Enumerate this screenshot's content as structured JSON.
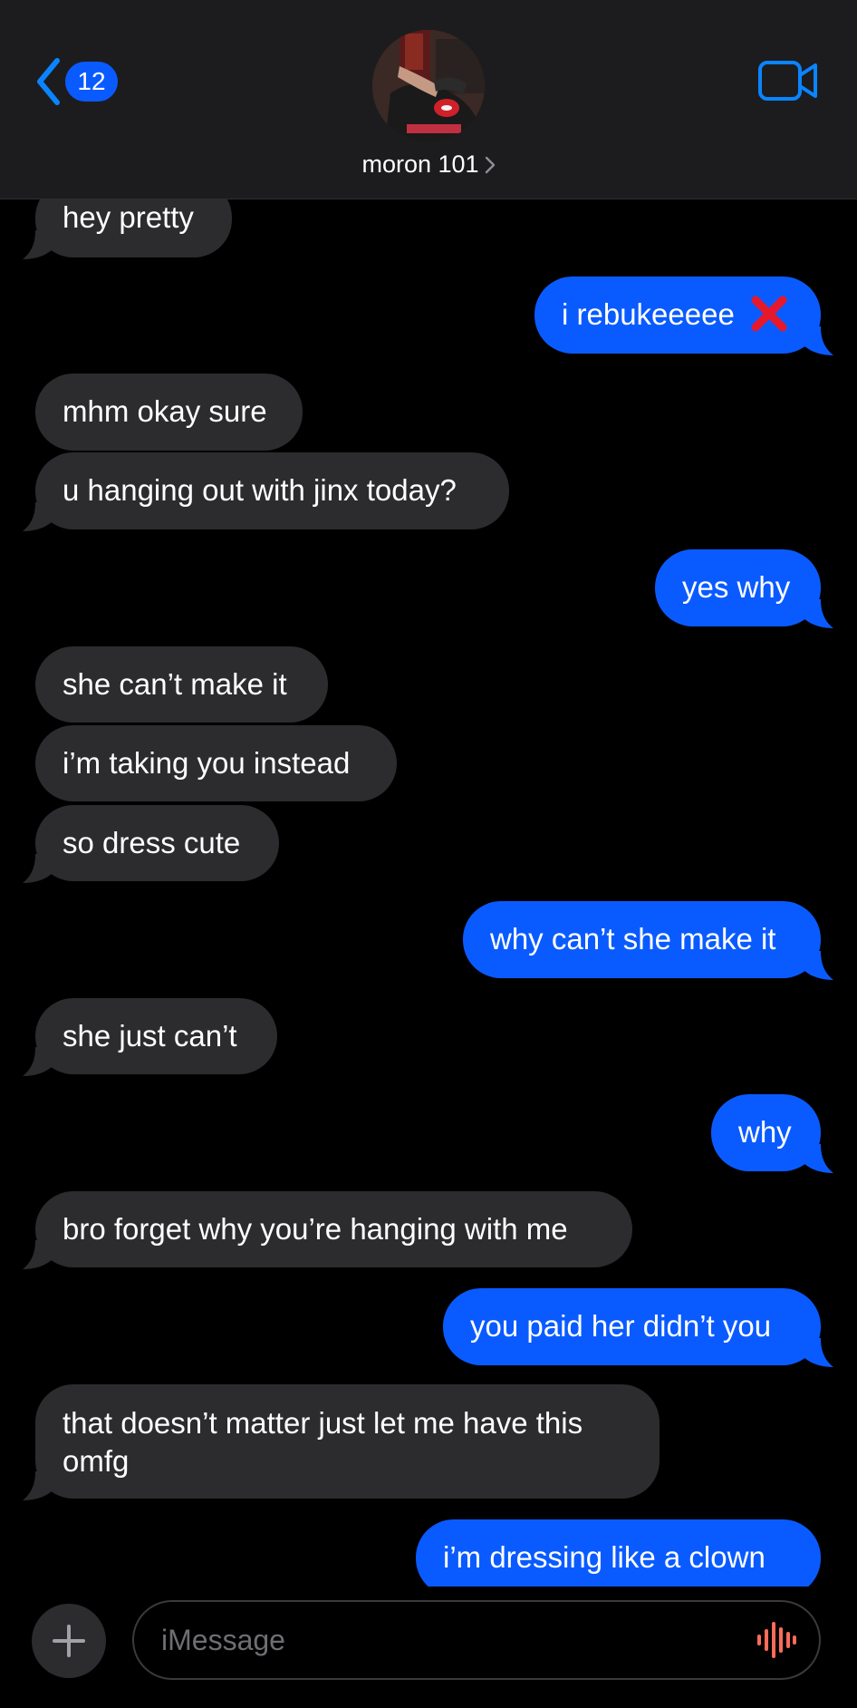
{
  "header": {
    "unread_count": "12",
    "contact_name": "moron 101"
  },
  "messages": [
    {
      "side": "in",
      "text": "hey pretty"
    },
    {
      "side": "out",
      "text": "i rebukeeeee",
      "emoji": "red-cross-mark"
    },
    {
      "side": "in",
      "text": "mhm okay sure"
    },
    {
      "side": "in",
      "text": "u hanging out with jinx today?"
    },
    {
      "side": "out",
      "text": "yes why"
    },
    {
      "side": "in",
      "text": "she can’t make it"
    },
    {
      "side": "in",
      "text": "i’m taking you instead"
    },
    {
      "side": "in",
      "text": "so dress cute"
    },
    {
      "side": "out",
      "text": "why can’t she make it"
    },
    {
      "side": "in",
      "text": "she just can’t"
    },
    {
      "side": "out",
      "text": "why"
    },
    {
      "side": "in",
      "text": "bro forget why you’re hanging with me"
    },
    {
      "side": "out",
      "text": "you paid her didn’t you"
    },
    {
      "side": "in",
      "text": "that doesn’t matter just let me have this omfg"
    },
    {
      "side": "out",
      "text": "i’m dressing like a clown"
    }
  ],
  "composer": {
    "placeholder": "iMessage"
  },
  "colors": {
    "incoming_bubble": "#2c2c2e",
    "outgoing_bubble": "#0a5bff",
    "accent": "#0a84ff",
    "header_bg": "#1c1c1e",
    "voice_icon": "#ff6b5a"
  },
  "icons": {
    "back": "chevron-left-icon",
    "video": "video-camera-icon",
    "plus": "plus-icon",
    "voice": "waveform-icon",
    "details": "chevron-right-icon"
  }
}
